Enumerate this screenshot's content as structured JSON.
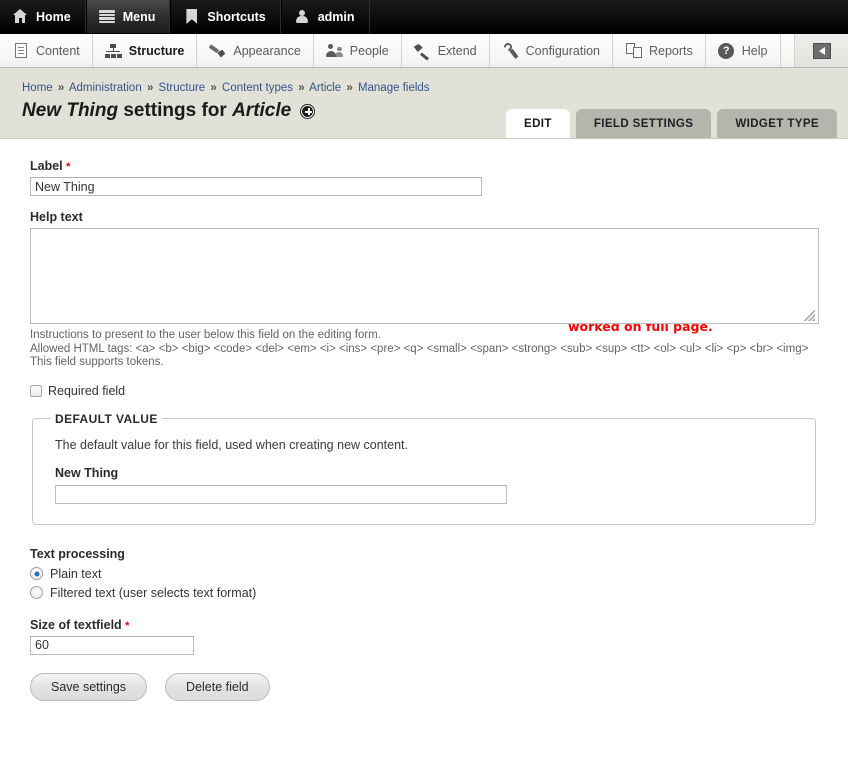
{
  "toolbar_top": {
    "items": [
      {
        "label": "Home",
        "icon": "home-icon",
        "active": false
      },
      {
        "label": "Menu",
        "icon": "hamburger-icon",
        "active": true
      },
      {
        "label": "Shortcuts",
        "icon": "bookmark-icon",
        "active": false
      },
      {
        "label": "admin",
        "icon": "user-icon",
        "active": false
      }
    ]
  },
  "toolbar_secondary": {
    "items": [
      {
        "label": "Content",
        "icon": "document-icon",
        "active": false
      },
      {
        "label": "Structure",
        "icon": "sitemap-icon",
        "active": true
      },
      {
        "label": "Appearance",
        "icon": "paintbrush-icon",
        "active": false
      },
      {
        "label": "People",
        "icon": "people-icon",
        "active": false
      },
      {
        "label": "Extend",
        "icon": "plug-icon",
        "active": false
      },
      {
        "label": "Configuration",
        "icon": "wrench-icon",
        "active": false
      },
      {
        "label": "Reports",
        "icon": "reports-icon",
        "active": false
      },
      {
        "label": "Help",
        "icon": "question-mark-icon",
        "active": false
      }
    ],
    "collapse_icon": "collapse-left-icon"
  },
  "breadcrumb": {
    "items": [
      "Home",
      "Administration",
      "Structure",
      "Content types",
      "Article",
      "Manage fields"
    ],
    "separator": "»"
  },
  "page": {
    "title_field": "New Thing",
    "title_middle": "settings for",
    "title_bundle": "Article",
    "title_badge_icon": "plus-circle-icon"
  },
  "tabs": [
    {
      "label": "EDIT",
      "active": true
    },
    {
      "label": "FIELD SETTINGS",
      "active": false
    },
    {
      "label": "WIDGET TYPE",
      "active": false
    }
  ],
  "annotation": {
    "text": "switched out of overlay so capture worked on full page.",
    "color": "#fe0000"
  },
  "form": {
    "label_field": {
      "label": "Label",
      "required_marker": "*",
      "value": "New Thing",
      "placeholder": ""
    },
    "help_text": {
      "label": "Help text",
      "value": "",
      "placeholder": "",
      "description_lines": [
        "Instructions to present to the user below this field on the editing form.",
        "Allowed HTML tags: <a> <b> <big> <code> <del> <em> <i> <ins> <pre> <q> <small> <span> <strong> <sub> <sup> <tt> <ol> <ul> <li> <p> <br> <img>",
        "This field supports tokens."
      ]
    },
    "required_field": {
      "label": "Required field",
      "checked": false
    },
    "default_value": {
      "legend": "DEFAULT VALUE",
      "description": "The default value for this field, used when creating new content.",
      "field_label": "New Thing",
      "field_value": "",
      "field_placeholder": ""
    },
    "text_processing": {
      "label": "Text processing",
      "options": [
        {
          "label": "Plain text",
          "selected": true
        },
        {
          "label": "Filtered text (user selects text format)",
          "selected": false
        }
      ]
    },
    "size_of_textfield": {
      "label": "Size of textfield",
      "required_marker": "*",
      "value": "60",
      "placeholder": ""
    },
    "buttons": {
      "save": "Save settings",
      "delete": "Delete field"
    }
  }
}
